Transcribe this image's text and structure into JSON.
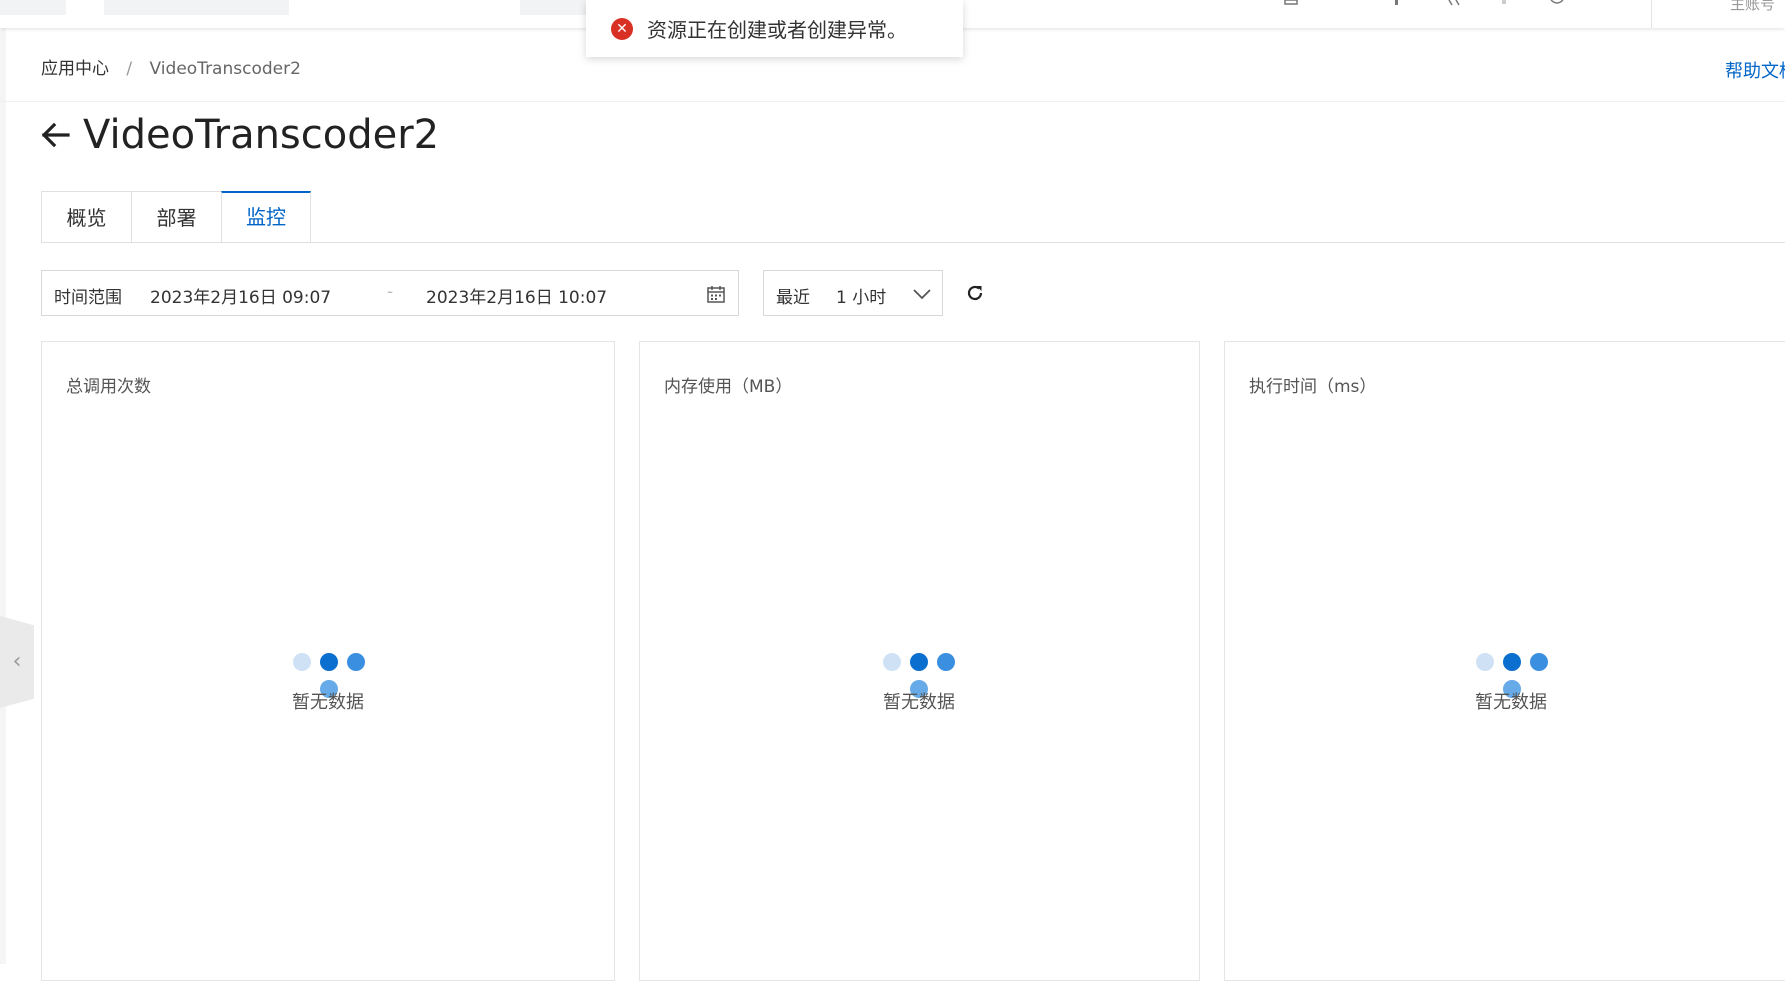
{
  "toast": {
    "icon": "error-circle-icon",
    "message": "资源正在创建或者创建异常。",
    "icon_color": "#d93026"
  },
  "header": {
    "account": "主账号"
  },
  "breadcrumb": {
    "root": "应用中心",
    "separator": "/",
    "current": "VideoTranscoder2"
  },
  "help_link": "帮助文档",
  "page_title": "VideoTranscoder2",
  "tabs": [
    {
      "label": "概览",
      "active": false
    },
    {
      "label": "部署",
      "active": false
    },
    {
      "label": "监控",
      "active": true
    }
  ],
  "filters": {
    "time_range_label": "时间范围",
    "start": "2023年2月16日 09:07",
    "dash": "-",
    "end": "2023年2月16日 10:07",
    "recent_label": "最近",
    "recent_value": "1 小时"
  },
  "cards": [
    {
      "title": "总调用次数",
      "empty_text": "暂无数据"
    },
    {
      "title": "内存使用（MB）",
      "empty_text": "暂无数据"
    },
    {
      "title": "执行时间（ms）",
      "empty_text": "暂无数据"
    }
  ],
  "colors": {
    "accent": "#0064c8",
    "error": "#d93026"
  }
}
